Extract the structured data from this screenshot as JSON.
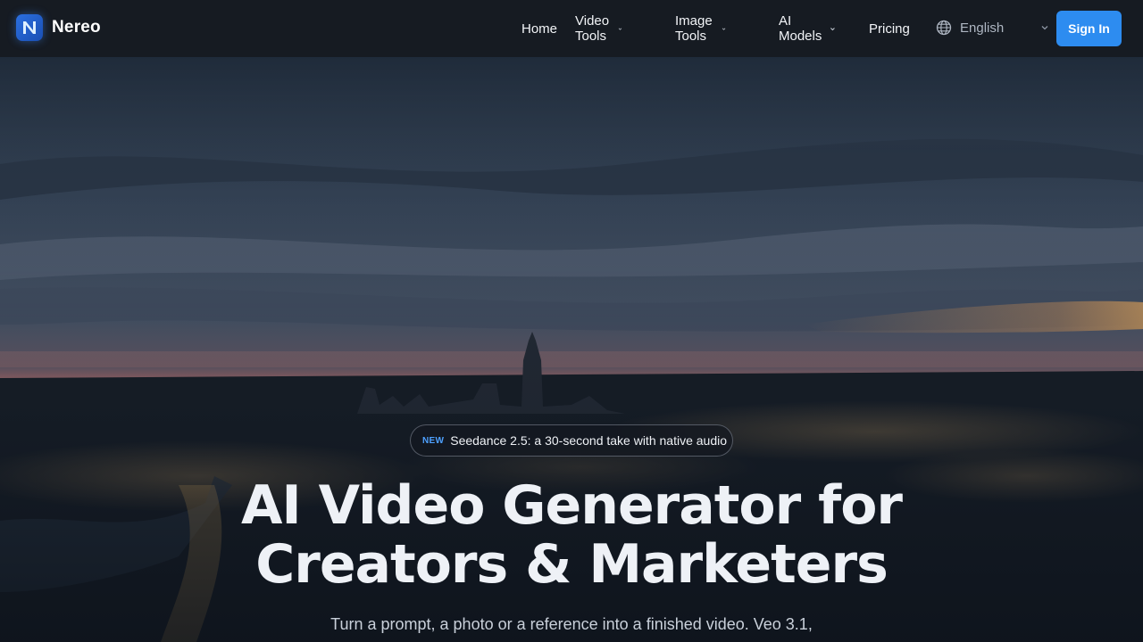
{
  "brand": {
    "name": "Nereo",
    "logo_icon": "n-logo-icon",
    "accent": "#2d8cf0"
  },
  "nav": {
    "items": [
      {
        "label": "Home",
        "has_dropdown": false
      },
      {
        "label": "Video Tools",
        "has_dropdown": true
      },
      {
        "label": "Image Tools",
        "has_dropdown": true
      },
      {
        "label": "AI Models",
        "has_dropdown": true
      },
      {
        "label": "Pricing",
        "has_dropdown": false
      }
    ],
    "language": {
      "icon": "globe-icon",
      "value": "English"
    },
    "signin_label": "Sign In"
  },
  "hero": {
    "badge": {
      "tag": "NEW",
      "text": "Seedance 2.5: a 30-second take with native audio"
    },
    "headline_line1": "AI Video Generator for",
    "headline_line2": "Creators & Marketers",
    "subline": "Turn a prompt, a photo or a reference into a finished video. Veo 3.1,"
  }
}
